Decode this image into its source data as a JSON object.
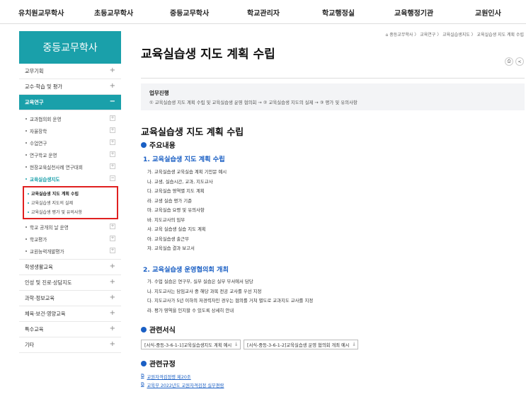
{
  "topnav": [
    "유치원교무학사",
    "초등교무학사",
    "중등교무학사",
    "학교관리자",
    "학교행정실",
    "교육행정기관",
    "교원인사"
  ],
  "sidebar": {
    "title": "중등교무학사",
    "top_items": [
      "교무기획",
      "교수·학습 및 평가"
    ],
    "active_item": "교육연구",
    "sub_items_before": [
      "교과협의회 운영",
      "자율장학",
      "수업연구",
      "연구학교 운영",
      "현장교육실천사례 연구대회"
    ],
    "current_sub": "교육실습생지도",
    "third_items": [
      "교육실습생 지도 계획 수립",
      "교육실습생 지도의 실제",
      "교육실습생 평가 및 유의사항"
    ],
    "sub_items_after": [
      "학교 공개의 날 운영",
      "학교평가",
      "교원능력개발평가"
    ],
    "bottom_items": [
      "학생생활교육",
      "인성 및 진로·상담지도",
      "과학·정보교육",
      "체육·보건·영양교육",
      "특수교육",
      "기타"
    ]
  },
  "breadcrumb": "중등교무학사 〉 교육연구 〉 교육실습생지도 〉 교육실습생 지도 계획 수립",
  "page_title": "교육실습생 지도 계획 수립",
  "process": {
    "title": "업무진행",
    "desc": "① 교육실습생 지도 계획 수립 및 교육실습생 운영 협의회 → ② 교육실습생 지도의 실제 → ③ 평가 및 유의사항"
  },
  "section_title": "교육실습생 지도 계획 수립",
  "main_content": {
    "heading": "주요내용",
    "sub1": "1. 교육실습생 지도 계획 수립",
    "list1": [
      "가. 교육실습생 교육실습 계획 기안문 예시",
      "나. 교생, 실습시간, 교과, 지도교사",
      "다. 교육실습 영역별 지도 계획",
      "라. 교생 실습 평가 기준",
      "마. 교육실습 요령 및 유의사항",
      "바. 지도교사의 임무",
      "사. 교육 실습생 실습 지도 계획",
      "아. 교육실습생 출근부",
      "자. 교육실습 결과 보고서"
    ],
    "sub2": "2. 교육실습생 운영협의회 개최",
    "list2": [
      "가. 수업 실습은 연구부, 실무 실습은 실무 부서에서 담당",
      "나. 지도교사는 담임교사 중 해당 과목 전공 교사를 우선 지정",
      "다. 지도교사가 5년 이하의 저경력자인 경우는 협의를 거쳐 별도로 교과지도 교사를 지정",
      "라. 평가 영역을 인지할 수 있도록 상세히 안내"
    ]
  },
  "forms": {
    "heading": "관련서식",
    "items": [
      "[서식-중등-3-6-1-1]교육실습생지도 계획 예시",
      "[서식-중등-3-6-1-2]교육실습생 운영 협의회 개최 예시"
    ]
  },
  "rules": {
    "heading": "관련규정",
    "items": [
      "교원자격검정령 제20조",
      "교육부 2022년도 교원자격검정 실무편람"
    ]
  },
  "colors": {
    "accent": "#1aa0aa",
    "link": "#1a5fc4",
    "highlight_border": "#e02020"
  }
}
